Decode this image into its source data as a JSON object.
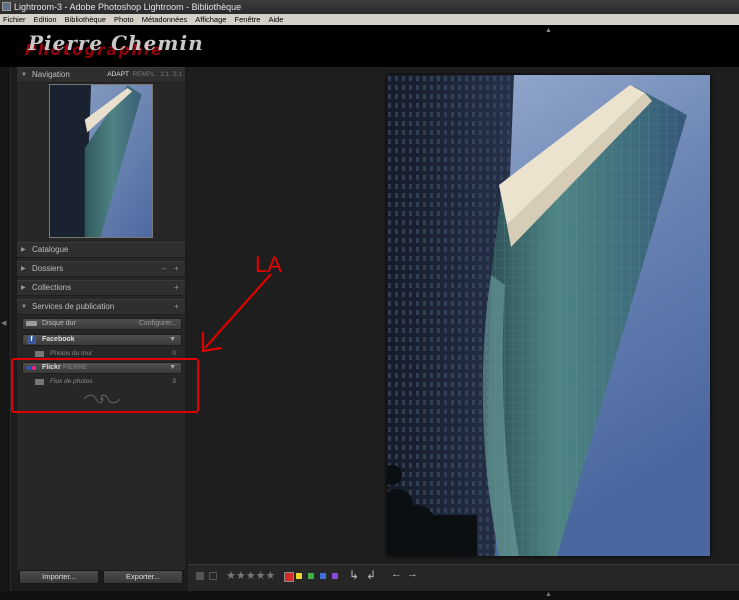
{
  "window": {
    "title": "Lightroom-3 - Adobe Photoshop Lightroom - Bibliothèque"
  },
  "menu": [
    "Fichier",
    "Edition",
    "Bibliothèque",
    "Photo",
    "Métadonnées",
    "Affichage",
    "Fenêtre",
    "Aide"
  ],
  "identity_plate": {
    "logo_text": "Pierre Chemin",
    "logo_subtext": "Photographie"
  },
  "navigator": {
    "label": "Navigation",
    "zoom_options": [
      "ADAPT",
      "REMPL.",
      "1:1",
      "2:1"
    ],
    "selected_zoom": "ADAPT"
  },
  "panels": {
    "catalog": "Catalogue",
    "folders": "Dossiers",
    "collections": "Collections",
    "publish_services": "Services de publication"
  },
  "publish": {
    "hard_drive": {
      "label": "Disque dur",
      "action": "Configurer..."
    },
    "facebook": {
      "label": "Facebook",
      "sub_label": "Photos du mur",
      "count": "0"
    },
    "flickr": {
      "label": "Flickr",
      "account": "PIERRE",
      "sub_label": "Flux de photos",
      "count": "3"
    }
  },
  "buttons": {
    "import": "Importer...",
    "export": "Exporter..."
  },
  "annotation": {
    "text": "LA",
    "color": "#e00000"
  },
  "toolbar": {
    "stars": "★★★★★",
    "color_labels": [
      "#d42b2b",
      "#e8d42a",
      "#3cb043",
      "#3a6fd8",
      "#8a4bd8"
    ]
  },
  "colors": {
    "panel_bg": "#272727",
    "sky": "#5b77a6"
  }
}
